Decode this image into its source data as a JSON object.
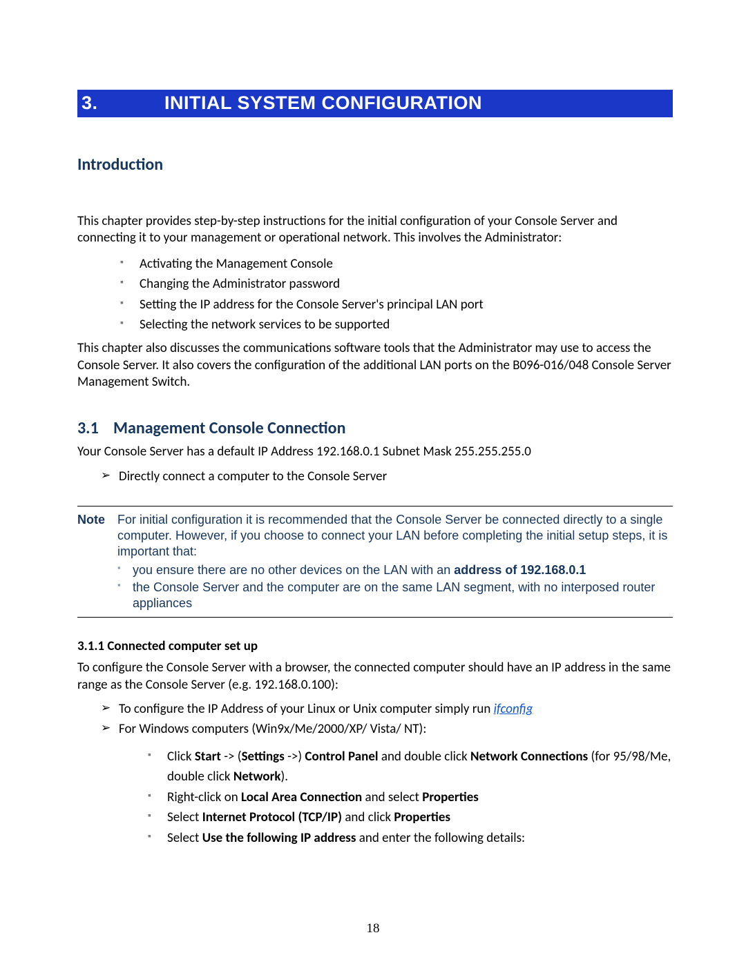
{
  "chapter": {
    "number": "3.",
    "title": "INITIAL SYSTEM CONFIGURATION"
  },
  "intro_heading": "Introduction",
  "intro_p1": "This chapter provides step-by-step instructions for the initial configuration of your Console Server and connecting it to your management or operational network. This involves the Administrator:",
  "intro_bullets": [
    "Activating  the Management Console",
    "Changing the Administrator password",
    "Setting the IP address for the Console Server's principal LAN port",
    "Selecting the network services to be supported"
  ],
  "intro_p2": "This chapter also discusses the communications software tools that the Administrator may use to access the Console Server. It also covers the configuration of the additional LAN ports on the B096-016/048 Console Server Management Switch.",
  "sec31": {
    "num": "3.1",
    "title": "Management Console Connection",
    "p1": "Your Console Server has a default IP Address 192.168.0.1 Subnet Mask 255.255.255.0",
    "arrow1": "Directly connect a computer to the Console Server"
  },
  "note": {
    "label": "Note",
    "text": "For initial configuration it is recommended that the Console Server be connected directly to a single computer. However, if you choose to connect your LAN before completing the initial setup steps, it is important that:",
    "b1_pre": "you ensure there are no other devices on the LAN with an ",
    "b1_bold": "address of 192.168.0.1",
    "b2": "the Console Server and the computer are on the same LAN segment, with no interposed router appliances"
  },
  "sec311": {
    "title": "3.1.1 Connected computer set up",
    "p1": "To configure the Console Server with a browser, the connected computer should have an IP address in the same range as the Console Server (e.g. 192.168.0.100):",
    "a1_pre": "To configure the IP Address of your Linux or Unix computer simply run ",
    "a1_link": "ifconfig",
    "a2": "For Windows computers (Win9x/Me/2000/XP/ Vista/ NT):",
    "sub": {
      "s1_a": "Click ",
      "s1_b": "Start",
      "s1_c": " -> (",
      "s1_d": "Settings",
      "s1_e": " ->) ",
      "s1_f": "Control Panel",
      "s1_g": " and double click ",
      "s1_h": "Network Connections",
      "s1_i": " (for 95/98/Me, double click ",
      "s1_j": "Network",
      "s1_k": ").",
      "s2_a": "Right-click on ",
      "s2_b": "Local Area Connection",
      "s2_c": " and select ",
      "s2_d": "Properties",
      "s3_a": "Select ",
      "s3_b": "Internet Protocol (TCP/IP)",
      "s3_c": " and click ",
      "s3_d": "Properties",
      "s4_a": "Select ",
      "s4_b": "Use the following IP address",
      "s4_c": " and enter the following details:"
    }
  },
  "page_number": "18"
}
